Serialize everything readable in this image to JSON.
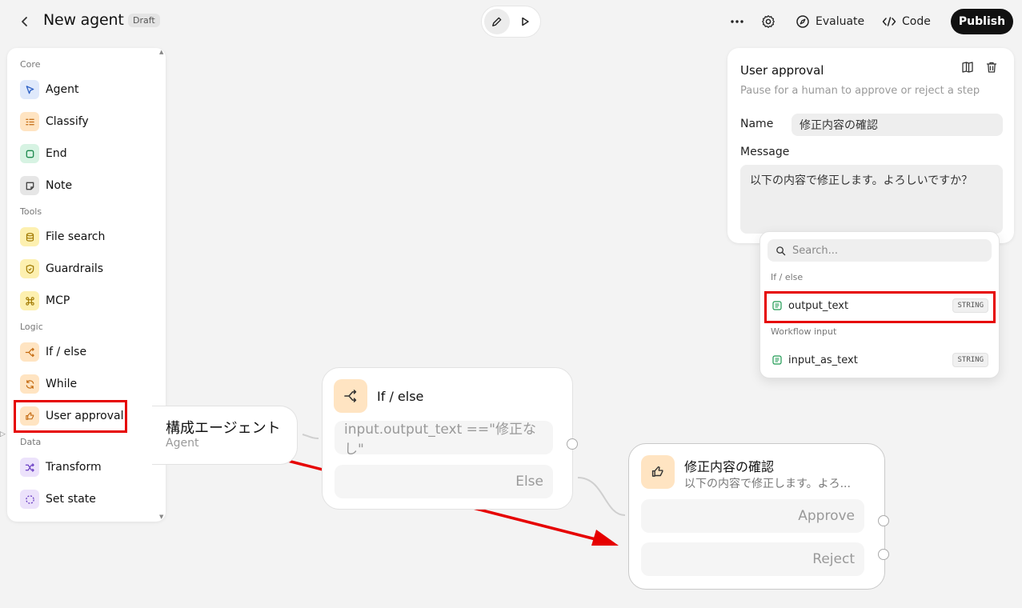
{
  "header": {
    "title": "New agent",
    "badge": "Draft",
    "evaluate_label": "Evaluate",
    "code_label": "Code",
    "publish_label": "Publish"
  },
  "palette": {
    "sections": {
      "core": "Core",
      "tools": "Tools",
      "logic": "Logic",
      "data": "Data"
    },
    "items": {
      "agent": "Agent",
      "classify": "Classify",
      "end": "End",
      "note": "Note",
      "file_search": "File search",
      "guardrails": "Guardrails",
      "mcp": "MCP",
      "if_else": "If / else",
      "while": "While",
      "user_approval": "User approval",
      "transform": "Transform",
      "set_state": "Set state"
    }
  },
  "canvas": {
    "agent_node": {
      "title": "構成エージェント",
      "subtitle": "Agent"
    },
    "ifelse_node": {
      "title": "If / else",
      "condition": "input.output_text ==\"修正なし\"",
      "else_label": "Else"
    },
    "approval_node": {
      "title": "修正内容の確認",
      "subtitle": "以下の内容で修正します。よろ...",
      "approve_label": "Approve",
      "reject_label": "Reject"
    }
  },
  "inspector": {
    "title": "User approval",
    "description": "Pause for a human to approve or reject a step",
    "name_label": "Name",
    "name_value": "修正内容の確認",
    "message_label": "Message",
    "message_value": "以下の内容で修正します。よろしいですか？"
  },
  "variable_picker": {
    "search_placeholder": "Search...",
    "groups": [
      {
        "label": "If / else",
        "items": [
          {
            "name": "output_text",
            "type": "STRING"
          }
        ]
      },
      {
        "label": "Workflow input",
        "items": [
          {
            "name": "input_as_text",
            "type": "STRING"
          }
        ]
      }
    ]
  },
  "colors": {
    "annotation_red": "#e60000",
    "publish_bg": "#111111",
    "canvas_bg": "#f3f3f3"
  }
}
